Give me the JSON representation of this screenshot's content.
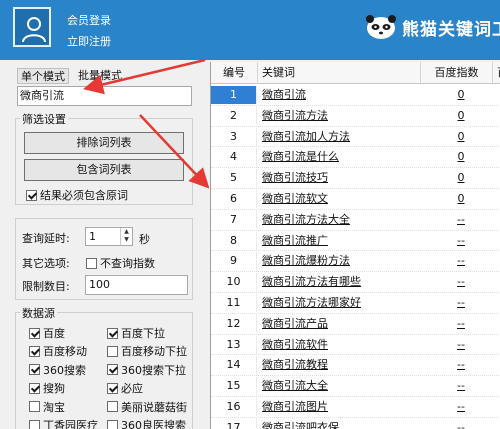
{
  "header": {
    "login_link": "会员登录",
    "register_link": "立即注册",
    "logo_text": "熊猫关键词工"
  },
  "left_panel": {
    "tabs": [
      {
        "label": "单个模式",
        "active": true
      },
      {
        "label": "批量模式",
        "active": false
      }
    ],
    "keyword_input": "微商引流",
    "filter_group": {
      "title": "筛选设置",
      "exclude_button": "排除词列表",
      "include_button": "包含词列表",
      "must_contain_checkbox": {
        "label": "结果必须包含原词",
        "checked": true
      }
    },
    "query_delay": {
      "label": "查询延时:",
      "value": "1",
      "unit": "秒"
    },
    "other_options": {
      "label": "其它选项:",
      "checkbox_label": "不查询指数",
      "checked": false
    },
    "limit_count": {
      "label": "限制数目:",
      "value": "100"
    },
    "data_sources": {
      "title": "数据源",
      "items": [
        {
          "label": "百度",
          "checked": true
        },
        {
          "label": "百度下拉",
          "checked": true
        },
        {
          "label": "百度移动",
          "checked": true
        },
        {
          "label": "百度移动下拉",
          "checked": false
        },
        {
          "label": "360搜索",
          "checked": true
        },
        {
          "label": "360搜索下拉",
          "checked": true
        },
        {
          "label": "搜狗",
          "checked": true
        },
        {
          "label": "必应",
          "checked": true
        },
        {
          "label": "淘宝",
          "checked": false
        },
        {
          "label": "美丽说蘑菇街",
          "checked": false
        },
        {
          "label": "丁香园医疗",
          "checked": false
        },
        {
          "label": "360良医搜索",
          "checked": false
        }
      ]
    }
  },
  "table": {
    "columns": [
      "编号",
      "关键词",
      "百度指数",
      "百"
    ],
    "rows": [
      {
        "no": "1",
        "keyword": "微商引流",
        "index": "0"
      },
      {
        "no": "2",
        "keyword": "微商引流方法",
        "index": "0"
      },
      {
        "no": "3",
        "keyword": "微商引流加人方法",
        "index": "0"
      },
      {
        "no": "4",
        "keyword": "微商引流是什么",
        "index": "0"
      },
      {
        "no": "5",
        "keyword": "微商引流技巧",
        "index": "0"
      },
      {
        "no": "6",
        "keyword": "微商引流软文",
        "index": "0"
      },
      {
        "no": "7",
        "keyword": "微商引流方法大全",
        "index": "--"
      },
      {
        "no": "8",
        "keyword": "微商引流推广",
        "index": "--"
      },
      {
        "no": "9",
        "keyword": "微商引流爆粉方法",
        "index": "--"
      },
      {
        "no": "10",
        "keyword": "微商引流方法有哪些",
        "index": "--"
      },
      {
        "no": "11",
        "keyword": "微商引流方法哪家好",
        "index": "--"
      },
      {
        "no": "12",
        "keyword": "微商引流产品",
        "index": "--"
      },
      {
        "no": "13",
        "keyword": "微商引流软件",
        "index": "--"
      },
      {
        "no": "14",
        "keyword": "微商引流教程",
        "index": "--"
      },
      {
        "no": "15",
        "keyword": "微商引流大全",
        "index": "--"
      },
      {
        "no": "16",
        "keyword": "微商引流图片",
        "index": "--"
      },
      {
        "no": "17",
        "keyword": "微商引流吧衣保",
        "index": "--"
      }
    ]
  },
  "colors": {
    "header_bg": "#2a84c9",
    "selected_row_bg": "#2f7fd4",
    "annotation_arrow": "#e53935"
  }
}
